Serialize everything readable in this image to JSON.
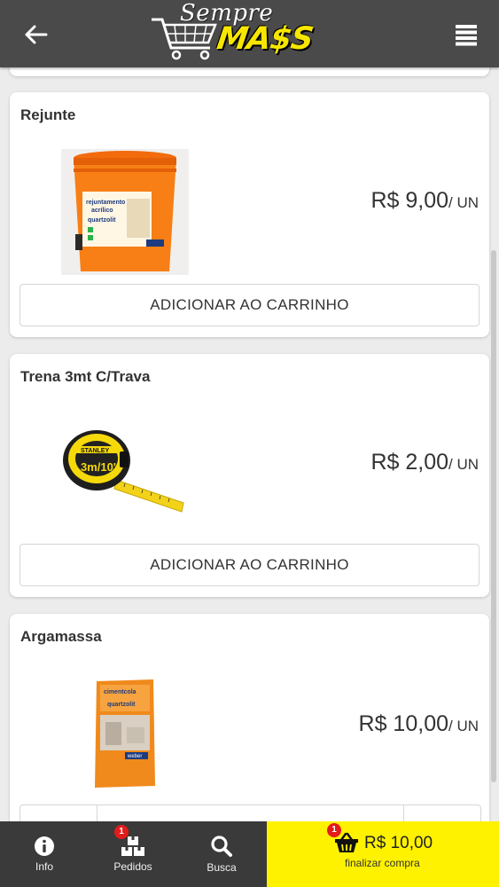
{
  "header": {
    "logo_script": "Sempre",
    "logo_mass": "MA$S",
    "back_icon": "arrow-left-icon",
    "menu_icon": "hamburger-menu-icon"
  },
  "products": [
    {
      "title": "Rejunte",
      "price": "R$ 9,00",
      "unit": "/ UN",
      "add_label": "ADICIONAR AO CARRINHO",
      "image_text": [
        "rejuntamento",
        "acrílico",
        "quartzolit"
      ]
    },
    {
      "title": "Trena 3mt C/Trava",
      "price": "R$ 2,00",
      "unit": "/ UN",
      "add_label": "ADICIONAR AO CARRINHO",
      "image_text": [
        "STANLEY",
        "3m/10'"
      ]
    },
    {
      "title": "Argamassa",
      "price": "R$ 10,00",
      "unit": "/ UN",
      "image_text": [
        "cimentcola",
        "quartzolit",
        "weber"
      ]
    }
  ],
  "bottom_nav": {
    "info_label": "Info",
    "pedidos_label": "Pedidos",
    "pedidos_badge": "1",
    "busca_label": "Busca",
    "cart_badge": "1",
    "cart_total": "R$ 10,00",
    "checkout_label": "finalizar compra"
  },
  "colors": {
    "header_bg": "#4a4a4a",
    "accent_yellow": "#fff200",
    "badge_red": "#e41b1b"
  }
}
